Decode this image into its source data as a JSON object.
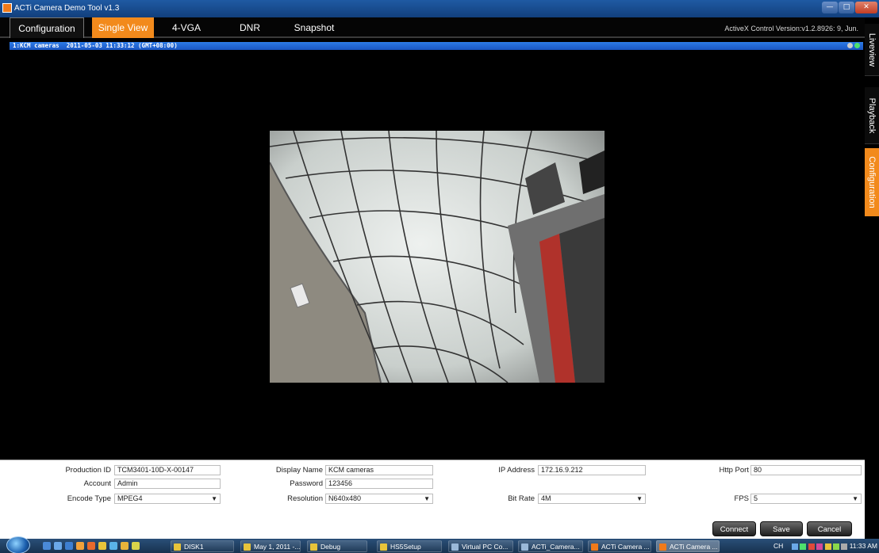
{
  "window": {
    "title": "ACTi Camera Demo Tool v1.3"
  },
  "tabs": {
    "configuration": "Configuration",
    "single_view": "Single View",
    "vga": "4-VGA",
    "dnr": "DNR",
    "snapshot": "Snapshot",
    "active_tab": "Single View"
  },
  "activex_version": "ActiveX Control Version:v1.2.8926: 9, Jun.",
  "camera_header": "1:KCM cameras  2011-05-03 11:33:12 (GMT+08:00)",
  "side_tabs": {
    "liveview": "Liveview",
    "playback": "Playback",
    "configuration": "Configuration"
  },
  "form": {
    "production_id": {
      "label": "Production ID",
      "value": "TCM3401-10D-X-00147"
    },
    "display_name": {
      "label": "Display Name",
      "value": "KCM cameras"
    },
    "ip_address": {
      "label": "IP Address",
      "value": "172.16.9.212"
    },
    "http_port": {
      "label": "Http Port",
      "value": "80"
    },
    "account": {
      "label": "Account",
      "value": "Admin"
    },
    "password": {
      "label": "Password",
      "value": "123456"
    },
    "encode_type": {
      "label": "Encode Type",
      "value": "MPEG4"
    },
    "resolution": {
      "label": "Resolution",
      "value": "N640x480"
    },
    "bit_rate": {
      "label": "Bit Rate",
      "value": "4M"
    },
    "fps": {
      "label": "FPS",
      "value": "5"
    }
  },
  "buttons": {
    "connect": "Connect",
    "save": "Save",
    "cancel": "Cancel"
  },
  "taskbar": {
    "items": [
      "DISK1",
      "May 1, 2011 -...",
      "Debug",
      "HS5Setup",
      "Virtual PC Co...",
      "ACTi_Camera...",
      "ACTi Camera ...",
      "ACTi Camera ..."
    ],
    "language": "CH",
    "clock": "11:33 AM"
  },
  "colors": {
    "accent_orange": "#f28a1c",
    "header_blue": "#1a56c4"
  }
}
